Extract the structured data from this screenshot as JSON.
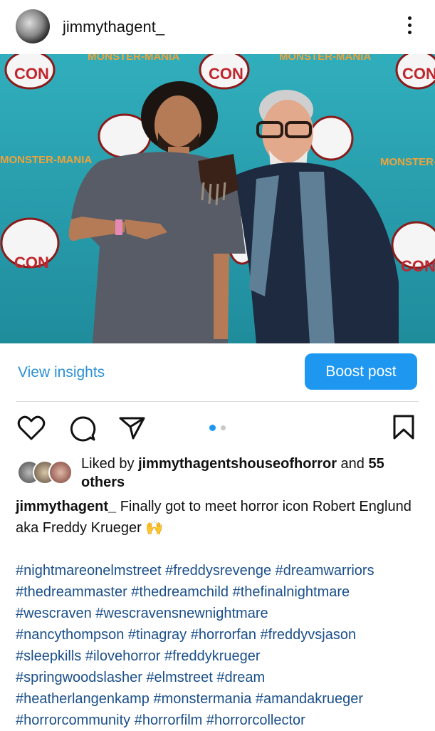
{
  "post": {
    "username": "jimmythagent_",
    "view_insights": "View insights",
    "boost_post": "Boost post",
    "likes": {
      "prefix": "Liked by ",
      "liker": "jimmythagentshouseofhorror",
      "middle": " and ",
      "count": "55",
      "suffix": "others"
    },
    "caption": {
      "author": "jimmythagent_",
      "text": " Finally got to meet horror icon Robert Englund aka Freddy Krueger 🙌"
    },
    "hashtag_lines": [
      "#nightmareonelmstreet #freddysrevenge #dreamwarriors",
      "#thedreammaster #thedreamchild #thefinalnightmare",
      "#wescraven #wescravensnewnightmare",
      "#nancythompson #tinagray #horrorfan #freddyvsjason",
      "#sleepkills #ilovehorror #freddykrueger",
      "#springwoodslasher #elmstreet #dream",
      "#heatherlangenkamp #monstermania #amandakrueger",
      "#horrorcommunity #horrorfilm #horrorcollector"
    ],
    "carousel": {
      "current": 1,
      "total": 2
    }
  },
  "photo": {
    "backdrop_text": "MONSTER-MANIA",
    "logo_text": "CON"
  },
  "colors": {
    "accent": "#1e97f0",
    "link": "#2b91d6",
    "hashtag": "#1a4f8a",
    "backdrop": "#2aa3b3"
  },
  "icons": [
    "more-vert-icon",
    "heart-icon",
    "comment-icon",
    "share-icon",
    "bookmark-icon"
  ]
}
